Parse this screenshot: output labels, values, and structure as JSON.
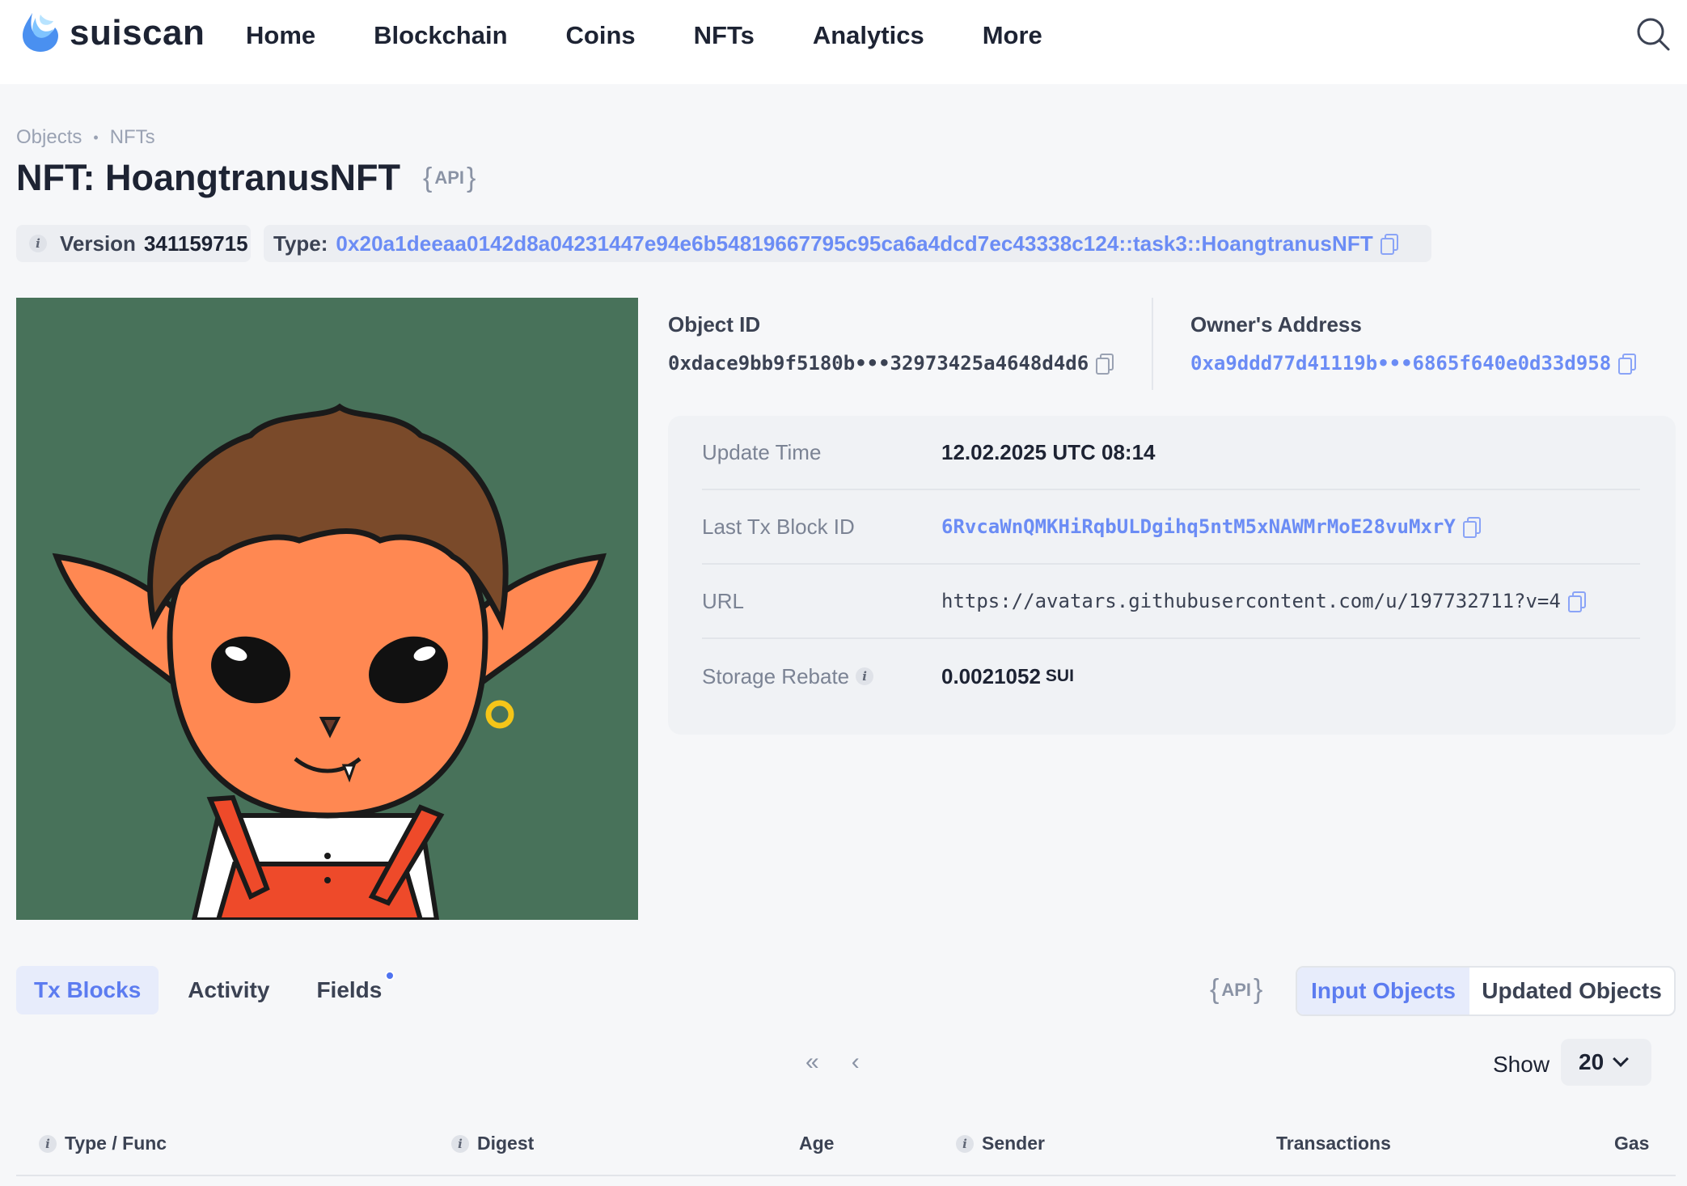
{
  "header": {
    "logo_text": "suiscan",
    "nav": [
      "Home",
      "Blockchain",
      "Coins",
      "NFTs",
      "Analytics",
      "More"
    ]
  },
  "breadcrumb": [
    "Objects",
    "NFTs"
  ],
  "title": "NFT: HoangtranusNFT",
  "api_label": "API",
  "version": {
    "label": "Version",
    "value": "341159715"
  },
  "type": {
    "label": "Type:",
    "value": "0x20a1deeaa0142d8a04231447e94e6b54819667795c95ca6a4dcd7ec43338c124::task3::HoangtranusNFT"
  },
  "object_id": {
    "label": "Object ID",
    "value": "0xdace9bb9f5180b•••32973425a4648d4d6"
  },
  "owner": {
    "label": "Owner's Address",
    "value": "0xa9ddd77d41119b•••6865f640e0d33d958"
  },
  "details": {
    "update_time": {
      "label": "Update Time",
      "value": "12.02.2025 UTC 08:14"
    },
    "last_tx": {
      "label": "Last Tx Block ID",
      "value": "6RvcaWnQMKHiRqbULDgihq5ntM5xNAWMrMoE28vuMxrY"
    },
    "url": {
      "label": "URL",
      "value": "https://avatars.githubusercontent.com/u/197732711?v=4"
    },
    "storage_rebate": {
      "label": "Storage Rebate",
      "value": "0.0021052",
      "unit": "SUI"
    }
  },
  "tabs": [
    "Tx Blocks",
    "Activity",
    "Fields"
  ],
  "objects_toggle": [
    "Input Objects",
    "Updated Objects"
  ],
  "pager": {
    "first": "«",
    "prev": "‹"
  },
  "show": {
    "label": "Show",
    "value": "20"
  },
  "table_columns": [
    "Type / Func",
    "Digest",
    "Age",
    "Sender",
    "Transactions",
    "Gas"
  ],
  "colors": {
    "accent": "#6b8cf5",
    "nft_bg": "#48725a"
  },
  "icons": [
    "suiscan-logo-icon",
    "search-icon",
    "info-icon",
    "copy-icon",
    "chevron-down-icon"
  ]
}
